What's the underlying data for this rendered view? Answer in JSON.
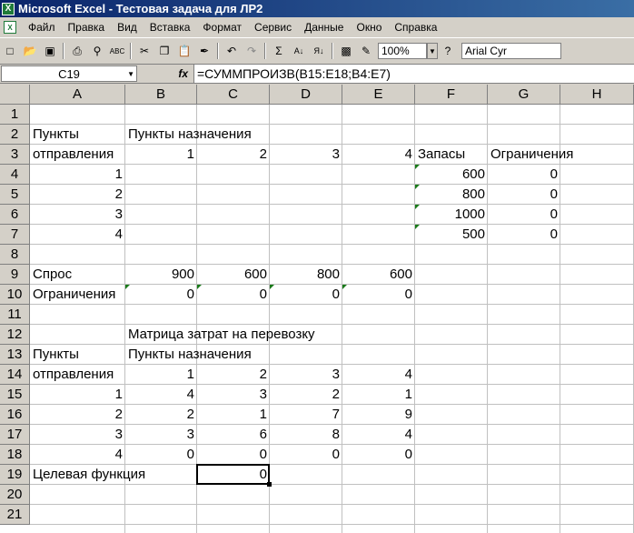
{
  "window": {
    "title": "Microsoft Excel - Тестовая задача для ЛР2"
  },
  "menu": [
    "Файл",
    "Правка",
    "Вид",
    "Вставка",
    "Формат",
    "Сервис",
    "Данные",
    "Окно",
    "Справка"
  ],
  "toolbar": {
    "zoom": "100%",
    "font": "Arial Cyr",
    "sum_symbol": "Σ"
  },
  "formula_bar": {
    "name_box": "C19",
    "fx": "fx",
    "formula": "=СУММПРОИЗВ(B15:E18;B4:E7)"
  },
  "columns": [
    "A",
    "B",
    "C",
    "D",
    "E",
    "F",
    "G",
    "H"
  ],
  "rows": [
    "1",
    "2",
    "3",
    "4",
    "5",
    "6",
    "7",
    "8",
    "9",
    "10",
    "11",
    "12",
    "13",
    "14",
    "15",
    "16",
    "17",
    "18",
    "19",
    "20",
    "21"
  ],
  "cells": {
    "A2": "Пункты",
    "B2": "Пункты назначения",
    "A3": "отправления",
    "B3": "1",
    "C3": "2",
    "D3": "3",
    "E3": "4",
    "F3": "Запасы",
    "G3": "Ограничения",
    "A4": "1",
    "F4": "600",
    "G4": "0",
    "A5": "2",
    "F5": "800",
    "G5": "0",
    "A6": "3",
    "F6": "1000",
    "G6": "0",
    "A7": "4",
    "F7": "500",
    "G7": "0",
    "A9": "Спрос",
    "B9": "900",
    "C9": "600",
    "D9": "800",
    "E9": "600",
    "A10": "Ограничения",
    "B10": "0",
    "C10": "0",
    "D10": "0",
    "E10": "0",
    "B12": "Матрица затрат на перевозку",
    "A13": "Пункты",
    "B13": "Пункты назначения",
    "A14": "отправления",
    "B14": "1",
    "C14": "2",
    "D14": "3",
    "E14": "4",
    "A15": "1",
    "B15": "4",
    "C15": "3",
    "D15": "2",
    "E15": "1",
    "A16": "2",
    "B16": "2",
    "C16": "1",
    "D16": "7",
    "E16": "9",
    "A17": "3",
    "B17": "3",
    "C17": "6",
    "D17": "8",
    "E17": "4",
    "A18": "4",
    "B18": "0",
    "C18": "0",
    "D18": "0",
    "E18": "0",
    "A19": "Целевая функция",
    "C19": "0"
  }
}
